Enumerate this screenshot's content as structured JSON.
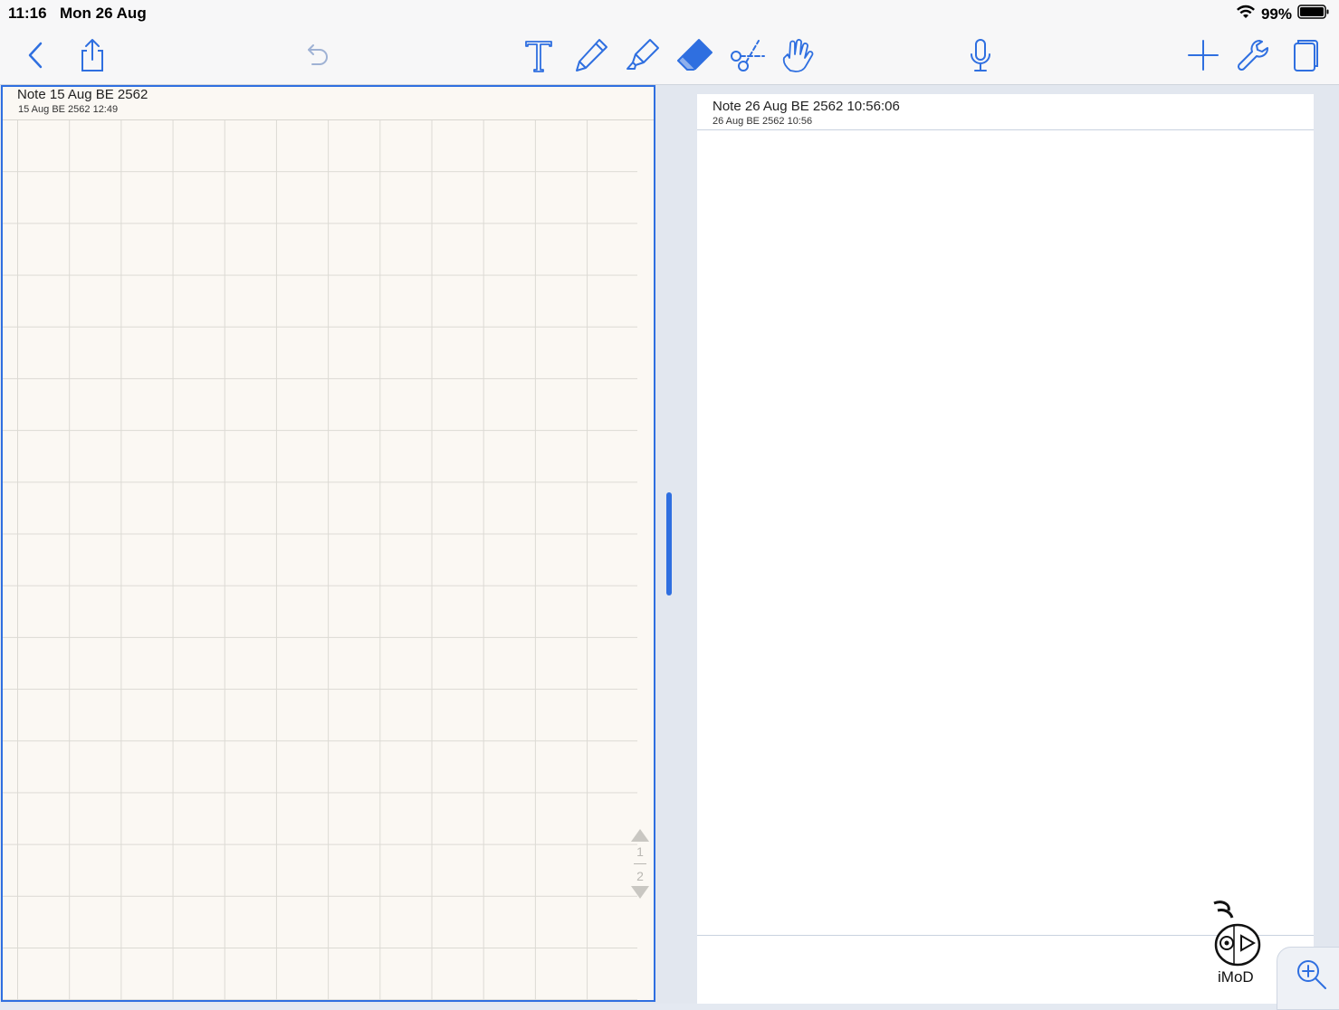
{
  "status_bar": {
    "time": "11:16",
    "date": "Mon 26 Aug",
    "battery": "99%"
  },
  "toolbar": {
    "icons": [
      "back-icon",
      "share-icon",
      "undo-icon",
      "text-tool-icon",
      "pen-icon",
      "highlighter-icon",
      "eraser-icon",
      "scissors-icon",
      "hand-pointer-icon",
      "microphone-icon",
      "add-icon",
      "wrench-icon",
      "pages-icon"
    ],
    "accent": "#2f6fe0",
    "undo_color": "#9fb2d4"
  },
  "left_note": {
    "title": "Note 15 Aug BE 2562",
    "date": "15 Aug BE 2562 12:49",
    "page_current": "1",
    "page_total": "2"
  },
  "right_note": {
    "title": "Note 26 Aug BE 2562 10:56:06",
    "date": "26 Aug BE 2562 10:56"
  },
  "watermark": {
    "text": "iMoD"
  }
}
